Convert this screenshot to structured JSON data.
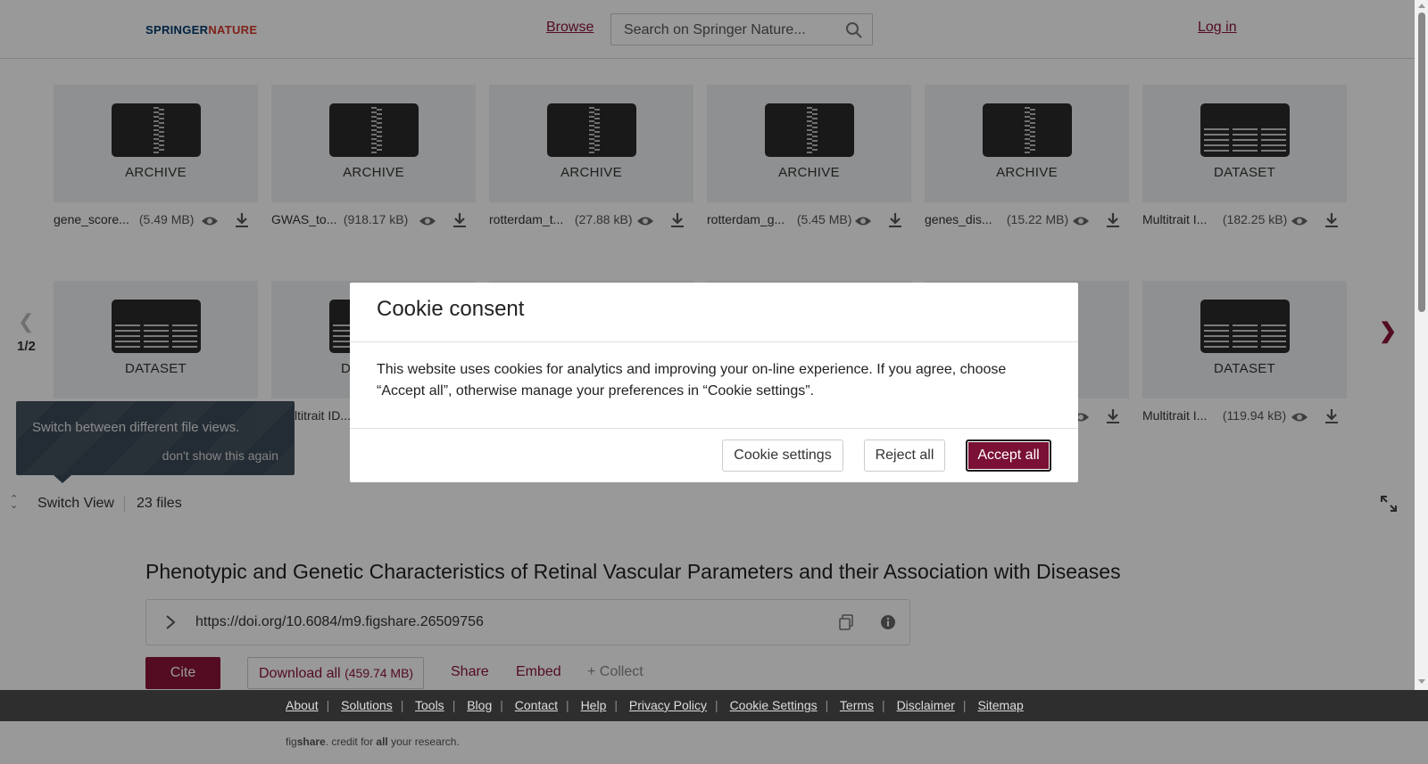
{
  "header": {
    "logo_part1": "SPRINGER",
    "logo_part2": "NATURE",
    "browse": "Browse",
    "search_placeholder": "Search on Springer Nature...",
    "login": "Log in"
  },
  "viewer": {
    "row1": [
      {
        "kind": "ARCHIVE",
        "name": "gene_score...",
        "size": "(5.49 MB)"
      },
      {
        "kind": "ARCHIVE",
        "name": "GWAS_to...",
        "size": "(918.17 kB)"
      },
      {
        "kind": "ARCHIVE",
        "name": "rotterdam_t...",
        "size": "(27.88 kB)"
      },
      {
        "kind": "ARCHIVE",
        "name": "rotterdam_g...",
        "size": "(5.45 MB)"
      },
      {
        "kind": "ARCHIVE",
        "name": "genes_dis...",
        "size": "(15.22 MB)"
      },
      {
        "kind": "DATASET",
        "name": "Multitrait I...",
        "size": "(182.25 kB)"
      }
    ],
    "row2": [
      {
        "kind": "DATASET"
      },
      {
        "kind": "D",
        "name": "ltitrait ID..."
      },
      {
        "kind": "DATASET",
        "name": "Multitrait I...",
        "size": "(119.94 kB)"
      }
    ],
    "page_indicator": "1/2",
    "switch_view": "Switch View",
    "file_count": "23 files"
  },
  "tooltip": {
    "text": "Switch between different file views.",
    "dismiss": "don't show this again"
  },
  "article": {
    "title": "Phenotypic and Genetic Characteristics of Retinal Vascular Parameters and their Association with Diseases",
    "doi": "https://doi.org/10.6084/m9.figshare.26509756",
    "cite": "Cite",
    "download_label": "Download all",
    "download_size": "(459.74 MB)",
    "share": "Share",
    "embed": "Embed",
    "collect": "+ Collect"
  },
  "footer": {
    "links": [
      "About",
      "Solutions",
      "Tools",
      "Blog",
      "Contact",
      "Help",
      "Privacy Policy",
      "Cookie Settings",
      "Terms",
      "Disclaimer",
      "Sitemap"
    ],
    "tag_fig": "fig",
    "tag_share": "share",
    "tag_rest1": ". credit for ",
    "tag_all": "all",
    "tag_rest2": " your research."
  },
  "cookie": {
    "title": "Cookie consent",
    "body": "This website uses cookies for analytics and improving your on-line experience. If you agree, choose “Accept all”, otherwise manage your preferences in “Cookie settings”.",
    "settings": "Cookie settings",
    "reject": "Reject all",
    "accept": "Accept all"
  },
  "colors": {
    "brand": "#8b1538",
    "accept_bg": "#7a1035",
    "footer_bg": "#2e2e2e"
  }
}
